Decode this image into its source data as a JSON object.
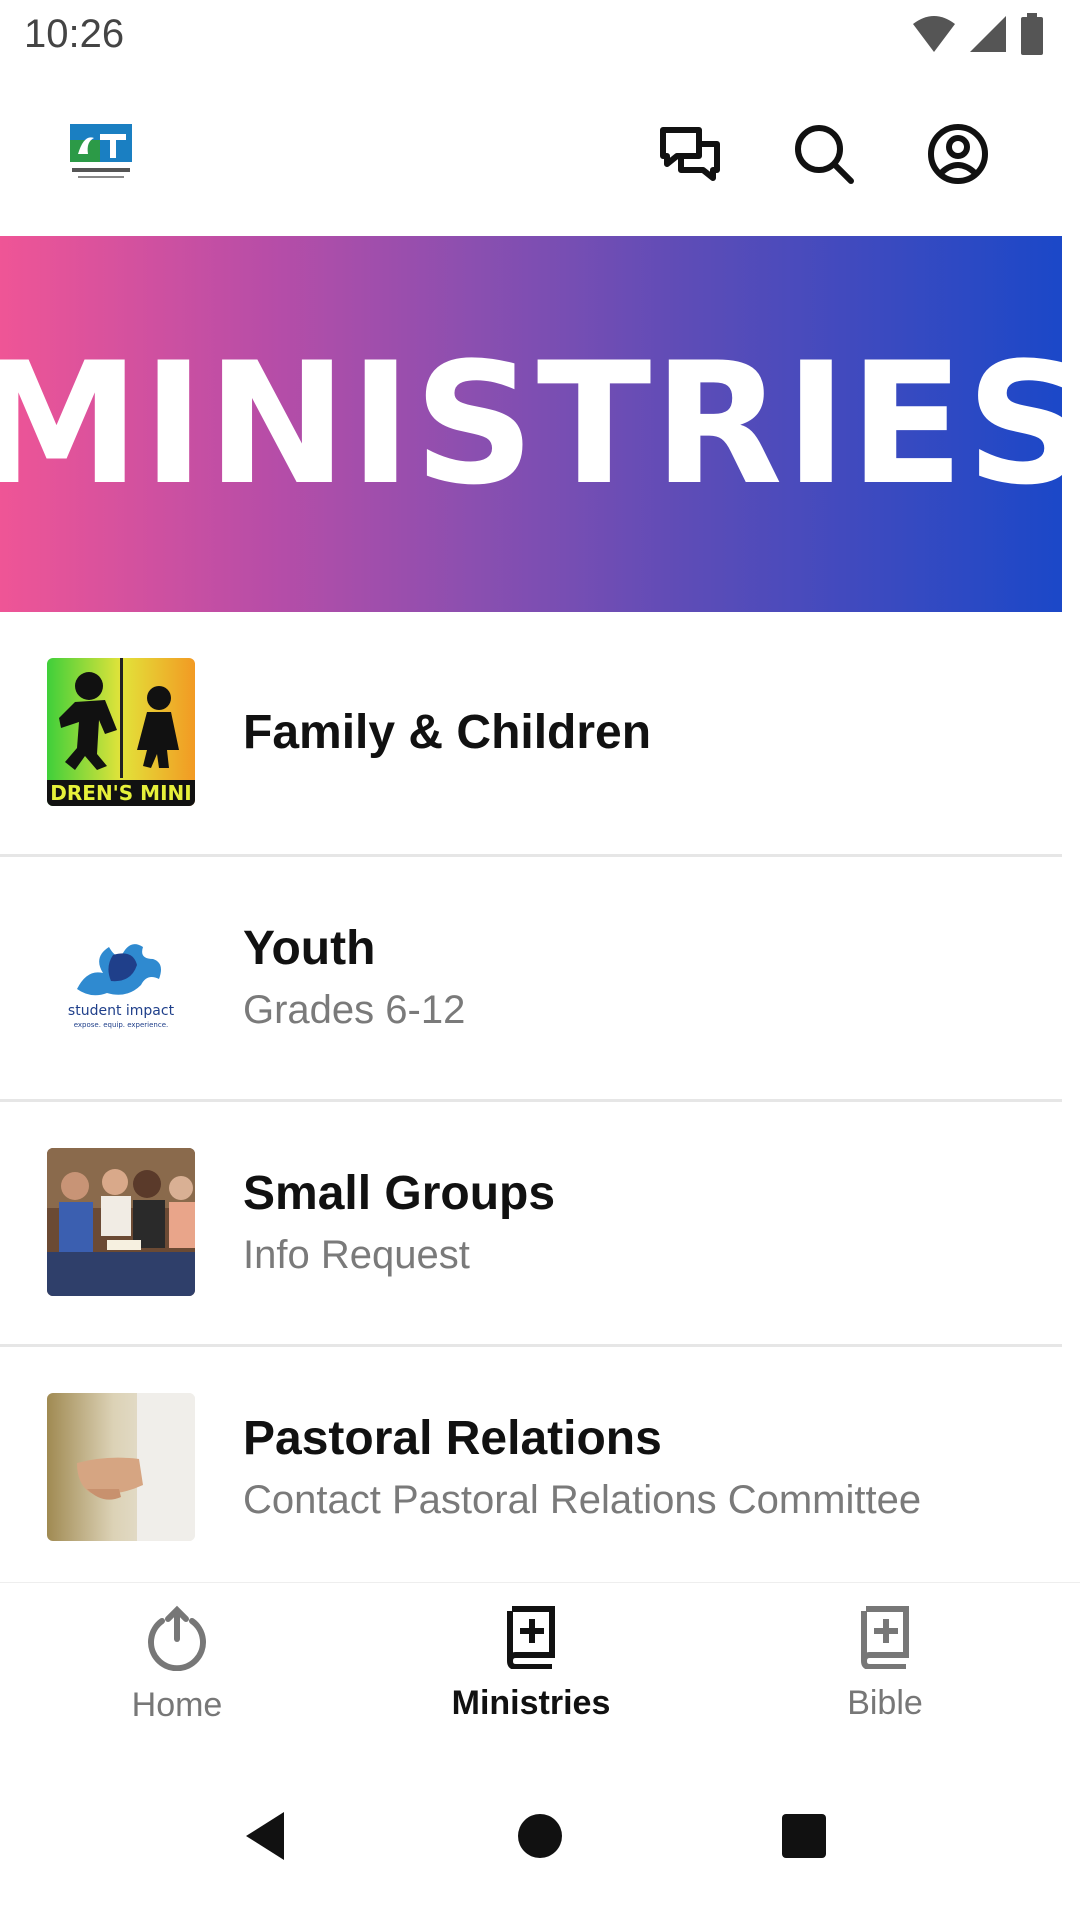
{
  "status_bar": {
    "time": "10:26",
    "icons": [
      "wifi-icon",
      "signal-icon",
      "battery-icon"
    ]
  },
  "app_bar": {
    "logo_icon": "church-logo",
    "actions": [
      {
        "name": "messages",
        "icon": "chat-bubbles-icon"
      },
      {
        "name": "search",
        "icon": "search-icon"
      },
      {
        "name": "profile",
        "icon": "account-circle-icon"
      }
    ]
  },
  "hero": {
    "title": "MINISTRIES",
    "gradient": [
      "#ef5596",
      "#1b48c8"
    ]
  },
  "ministries": [
    {
      "title": "Family & Children",
      "subtitle": "",
      "thumb": "children-ministry-image"
    },
    {
      "title": "Youth",
      "subtitle": "Grades 6-12",
      "thumb": "student-impact-logo"
    },
    {
      "title": "Small Groups",
      "subtitle": "Info Request",
      "thumb": "small-group-photo"
    },
    {
      "title": "Pastoral Relations",
      "subtitle": "Contact Pastoral Relations Committee",
      "thumb": "outstretched-hand-photo"
    }
  ],
  "bottom_nav": {
    "items": [
      {
        "label": "Home",
        "icon": "home-power-icon",
        "active": false
      },
      {
        "label": "Ministries",
        "icon": "book-plus-icon",
        "active": true
      },
      {
        "label": "Bible",
        "icon": "bible-icon",
        "active": false
      }
    ]
  },
  "system_nav": {
    "buttons": [
      "back",
      "home",
      "recents"
    ]
  }
}
